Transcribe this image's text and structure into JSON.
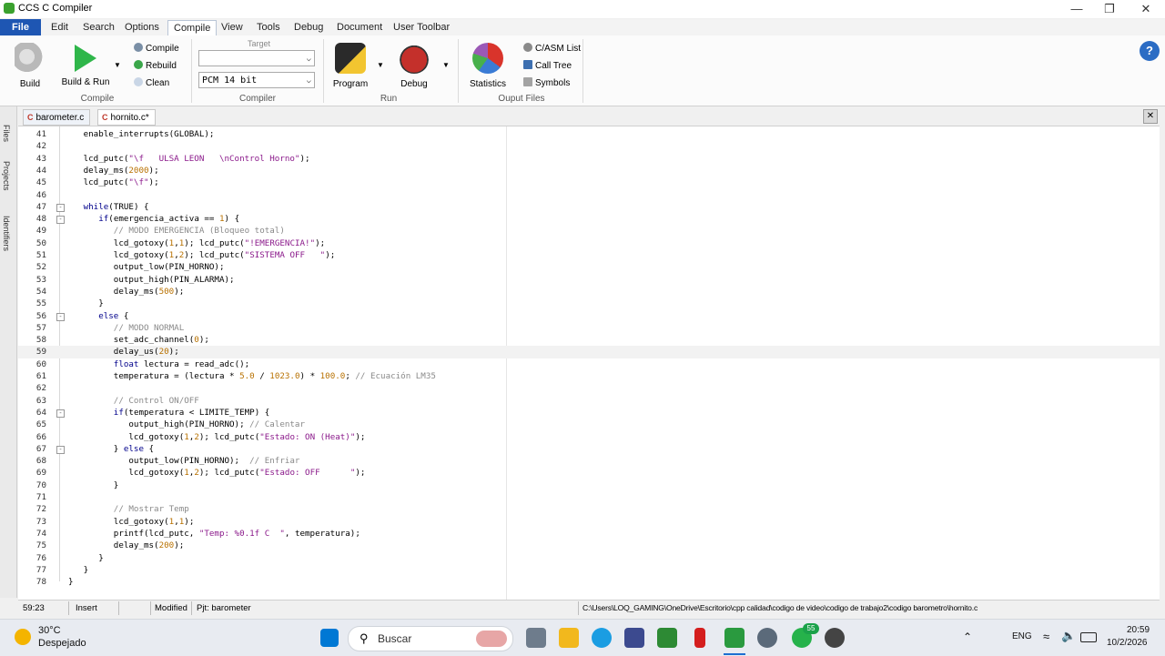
{
  "window": {
    "title": "CCS C Compiler"
  },
  "ribbon_tabs": [
    "File",
    "Edit",
    "Search",
    "Options",
    "Compile",
    "View",
    "Tools",
    "Debug",
    "Document",
    "User Toolbar"
  ],
  "ribbon": {
    "build_label": "Build",
    "build_run_label": "Build & Run",
    "compile_label": "Compile",
    "rebuild_label": "Rebuild",
    "clean_label": "Clean",
    "group_compile": "Compile",
    "target_label": "Target",
    "target_value": "",
    "compiler_value": "PCM 14 bit",
    "group_compiler": "Compiler",
    "program_label": "Program",
    "debug_label": "Debug",
    "group_run": "Run",
    "statistics_label": "Statistics",
    "casm_label": "C/ASM List",
    "calltree_label": "Call Tree",
    "symbols_label": "Symbols",
    "group_output": "Ouput Files"
  },
  "side_tabs": [
    "Files",
    "Projects",
    "Identifiers"
  ],
  "doc_tabs": [
    {
      "label": "barometer.c",
      "active": false
    },
    {
      "label": "hornito.c*",
      "active": true
    }
  ],
  "editor": {
    "lines": [
      {
        "n": "41",
        "code": "   enable_interrupts(GLOBAL);"
      },
      {
        "n": "42",
        "code": ""
      },
      {
        "n": "43",
        "code": "   lcd_putc(\"\\f   ULSA LEON   \\nControl Horno\");"
      },
      {
        "n": "44",
        "code": "   delay_ms(2000);"
      },
      {
        "n": "45",
        "code": "   lcd_putc(\"\\f\");"
      },
      {
        "n": "46",
        "code": ""
      },
      {
        "n": "47",
        "code": "   while(TRUE) {"
      },
      {
        "n": "48",
        "code": "      if(emergencia_activa == 1) {"
      },
      {
        "n": "49",
        "code": "         // MODO EMERGENCIA (Bloqueo total)"
      },
      {
        "n": "50",
        "code": "         lcd_gotoxy(1,1); lcd_putc(\"!EMERGENCIA!\");"
      },
      {
        "n": "51",
        "code": "         lcd_gotoxy(1,2); lcd_putc(\"SISTEMA OFF   \");"
      },
      {
        "n": "52",
        "code": "         output_low(PIN_HORNO);"
      },
      {
        "n": "53",
        "code": "         output_high(PIN_ALARMA);"
      },
      {
        "n": "54",
        "code": "         delay_ms(500);"
      },
      {
        "n": "55",
        "code": "      }"
      },
      {
        "n": "56",
        "code": "      else {"
      },
      {
        "n": "57",
        "code": "         // MODO NORMAL"
      },
      {
        "n": "58",
        "code": "         set_adc_channel(0);"
      },
      {
        "n": "59",
        "code": "         delay_us(20);"
      },
      {
        "n": "60",
        "code": "         float lectura = read_adc();"
      },
      {
        "n": "61",
        "code": "         temperatura = (lectura * 5.0 / 1023.0) * 100.0; // Ecuación LM35"
      },
      {
        "n": "62",
        "code": ""
      },
      {
        "n": "63",
        "code": "         // Control ON/OFF"
      },
      {
        "n": "64",
        "code": "         if(temperatura < LIMITE_TEMP) {"
      },
      {
        "n": "65",
        "code": "            output_high(PIN_HORNO); // Calentar"
      },
      {
        "n": "66",
        "code": "            lcd_gotoxy(1,2); lcd_putc(\"Estado: ON (Heat)\");"
      },
      {
        "n": "67",
        "code": "         } else {"
      },
      {
        "n": "68",
        "code": "            output_low(PIN_HORNO);  // Enfriar"
      },
      {
        "n": "69",
        "code": "            lcd_gotoxy(1,2); lcd_putc(\"Estado: OFF      \");"
      },
      {
        "n": "70",
        "code": "         }"
      },
      {
        "n": "71",
        "code": ""
      },
      {
        "n": "72",
        "code": "         // Mostrar Temp"
      },
      {
        "n": "73",
        "code": "         lcd_gotoxy(1,1);"
      },
      {
        "n": "74",
        "code": "         printf(lcd_putc, \"Temp: %0.1f C  \", temperatura);"
      },
      {
        "n": "75",
        "code": "         delay_ms(200);"
      },
      {
        "n": "76",
        "code": "      }"
      },
      {
        "n": "77",
        "code": "   }"
      },
      {
        "n": "78",
        "code": "}"
      }
    ]
  },
  "status": {
    "position": "59:23",
    "mode": "Insert",
    "modified": "Modified",
    "project": "Pjt: barometer",
    "path": "C:\\Users\\LOQ_GAMING\\OneDrive\\Escritorio\\cpp calidad\\codigo de video\\codigo de trabajo2\\codigo barometro\\hornito.c"
  },
  "taskbar": {
    "weather_temp": "30°C",
    "weather_desc": "Despejado",
    "search_placeholder": "Buscar",
    "lang": "ENG",
    "time": "20:59",
    "date": "10/2/2026",
    "whatsapp_badge": "55"
  },
  "colors": {
    "file_tab": "#1e56b3",
    "keyword": "#00008b",
    "comment": "#8a8a8a",
    "string": "#8b1a8b",
    "number": "#b87100"
  }
}
